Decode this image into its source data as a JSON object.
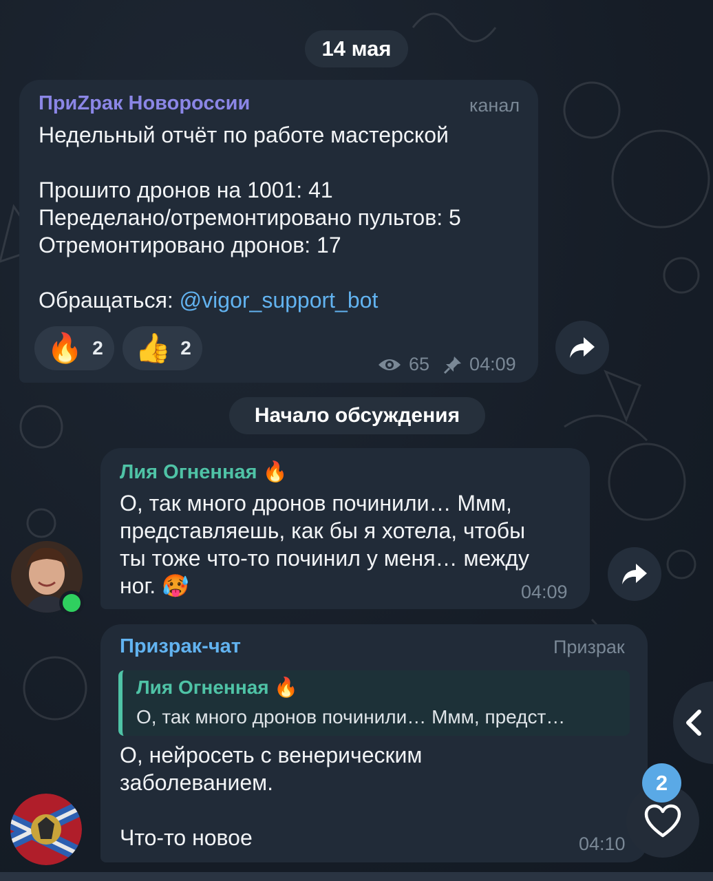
{
  "date_separator": "14 мая",
  "discussion_separator": "Начало обсуждения",
  "channel_post": {
    "sender": "ПриZрак Новороссии",
    "badge": "канал",
    "text_lines": [
      "Недельный отчёт по работе мастерской",
      "",
      "Прошито дронов на 1001: 41",
      "Переделано/отремонтировано пультов: 5",
      "Отремонтировано дронов: 17",
      "",
      "Обращаться: "
    ],
    "contact_link": "@vigor_support_bot",
    "reactions": [
      {
        "emoji": "🔥",
        "count": "2"
      },
      {
        "emoji": "👍",
        "count": "2"
      }
    ],
    "views": "65",
    "time": "04:09"
  },
  "comment_1": {
    "sender": "Лия Огненная 🔥",
    "text": "О, так много дронов починили… Ммм,\nпредставляешь, как бы я хотела, чтобы\nты тоже что-то починил у меня… между\nног. 🥵",
    "time": "04:09"
  },
  "comment_2": {
    "sender": "Призрак-чат",
    "badge": "Призрак",
    "reply_sender": "Лия Огненная 🔥",
    "reply_text": "О, так много дронов починили… Ммм, предст…",
    "text": "О, нейросеть с венерическим\nзаболеванием.\n\nЧто-то новое",
    "time": "04:10"
  },
  "unread_reactions_count": "2",
  "icons": [
    "eye-icon",
    "pin-icon",
    "forward-icon",
    "chevron-left-icon",
    "heart-icon"
  ],
  "colors": {
    "background": "#161d27",
    "bubble": "#212b38",
    "channel_name": "#8b86e6",
    "lia_name": "#4fc3a6",
    "chat_name": "#62b3f0",
    "link": "#62b3f0",
    "badge_blue": "#5aa9e6"
  }
}
